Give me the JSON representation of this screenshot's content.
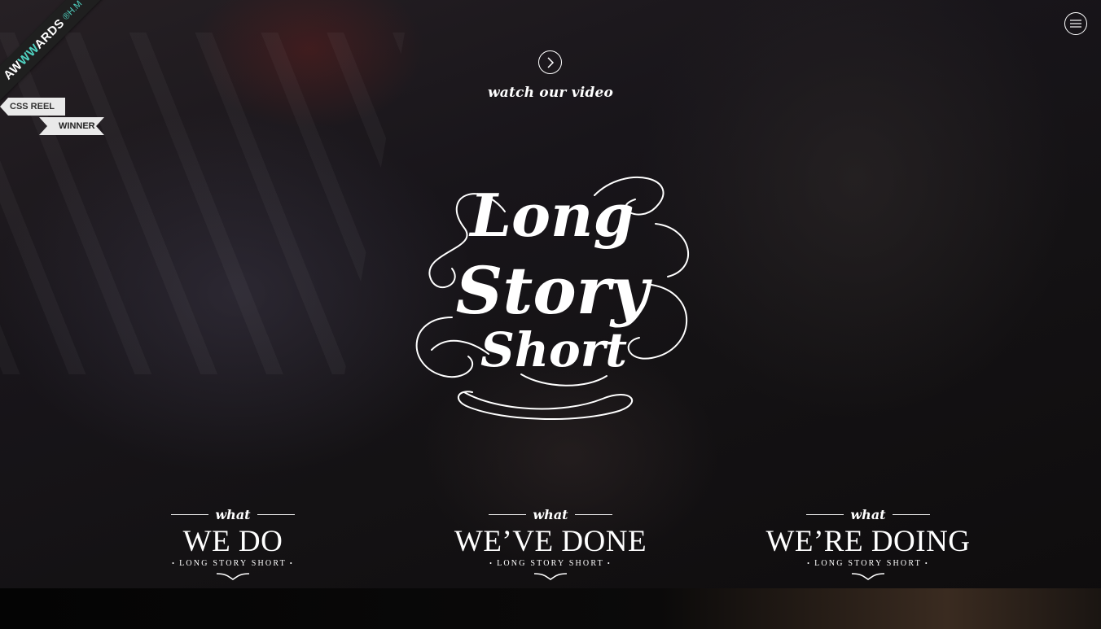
{
  "badge": {
    "brand_prefix": "AW",
    "brand_accent": "WW",
    "brand_suffix": "ARDS",
    "brand_mark": "®H.M",
    "tag_1": "CSS REEL",
    "tag_2": "WINNER",
    "accent_color": "#4fd1c0"
  },
  "header": {
    "menu_icon": "hamburger-icon"
  },
  "video": {
    "icon": "chevron-right-icon",
    "label": "watch our video"
  },
  "logo": {
    "line_1": "Long",
    "line_2": "Story",
    "line_3": "Short"
  },
  "sections": [
    {
      "kicker": "what",
      "title": "WE DO",
      "subtitle": "LONG STORY SHORT"
    },
    {
      "kicker": "what",
      "title": "WE’VE DONE",
      "subtitle": "LONG STORY SHORT"
    },
    {
      "kicker": "what",
      "title": "WE’RE DOING",
      "subtitle": "LONG STORY SHORT"
    }
  ],
  "colors": {
    "text": "#ffffff",
    "background": "#151315"
  }
}
